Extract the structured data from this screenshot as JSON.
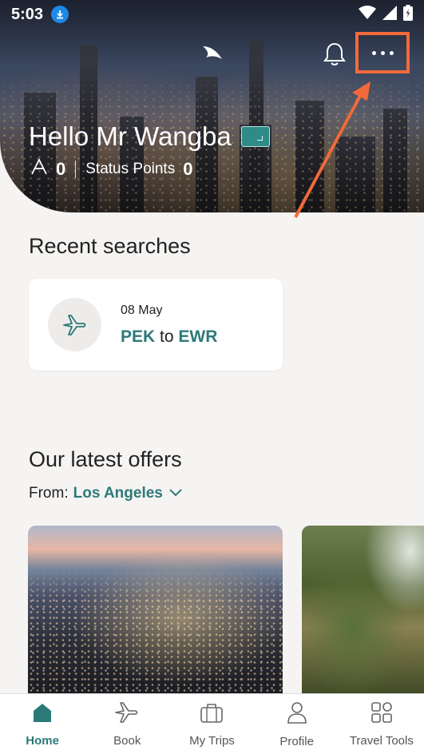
{
  "status_bar": {
    "time": "5:03"
  },
  "header": {
    "greeting": "Hello Mr Wangba",
    "asia_miles": "0",
    "status_points_label": "Status Points",
    "status_points": "0"
  },
  "recent_searches": {
    "title": "Recent searches",
    "items": [
      {
        "date": "08 May",
        "origin": "PEK",
        "connector": "to",
        "destination": "EWR"
      }
    ]
  },
  "offers": {
    "title": "Our latest offers",
    "from_label": "From:",
    "from_city": "Los Angeles"
  },
  "bottom_nav": {
    "items": [
      {
        "label": "Home",
        "icon": "home-icon",
        "active": true
      },
      {
        "label": "Book",
        "icon": "plane-icon"
      },
      {
        "label": "My Trips",
        "icon": "briefcase-icon"
      },
      {
        "label": "Profile",
        "icon": "person-icon"
      },
      {
        "label": "Travel Tools",
        "icon": "grid-icon"
      }
    ]
  },
  "colors": {
    "accent": "#2c7a78",
    "highlight": "#f26a3a",
    "background": "#f6f4f2"
  }
}
